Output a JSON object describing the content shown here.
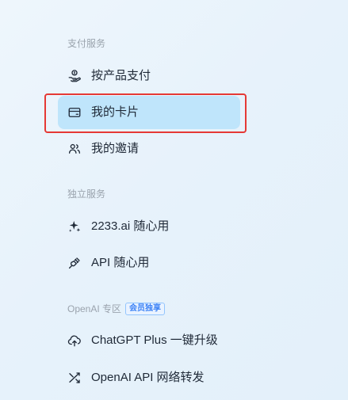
{
  "sections": [
    {
      "label": "支付服务",
      "badge": "",
      "items": [
        {
          "label": "按产品支付",
          "icon": "hand-coin-icon"
        },
        {
          "label": "我的卡片",
          "icon": "card-icon"
        },
        {
          "label": "我的邀请",
          "icon": "users-icon"
        }
      ]
    },
    {
      "label": "独立服务",
      "badge": "",
      "items": [
        {
          "label": "2233.ai 随心用",
          "icon": "sparkle-icon"
        },
        {
          "label": "API 随心用",
          "icon": "plug-icon"
        }
      ]
    },
    {
      "label": "OpenAI 专区",
      "badge": "会员独享",
      "items": [
        {
          "label": "ChatGPT Plus 一键升级",
          "icon": "cloud-upload-icon"
        },
        {
          "label": "OpenAI API 网络转发",
          "icon": "shuffle-icon"
        }
      ]
    }
  ],
  "active_item": "我的卡片",
  "colors": {
    "active_background": "#bfe5fb",
    "highlight_border": "#e53935",
    "section_label": "#9aa3ad",
    "badge": "#3b82f6"
  }
}
